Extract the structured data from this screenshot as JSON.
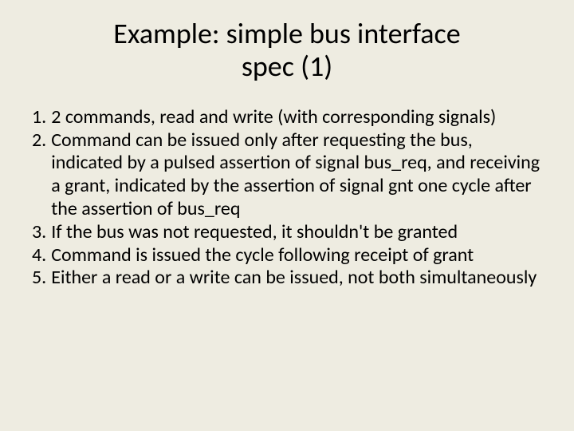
{
  "title": "Example: simple bus interface\nspec (1)",
  "items": [
    {
      "num": "1.",
      "text": "2 commands, read and write (with corresponding signals)"
    },
    {
      "num": "2.",
      "text": "Command can be issued only after requesting the bus, indicated by a pulsed assertion of signal bus_req, and receiving a grant, indicated by the assertion of signal gnt one cycle after the assertion of bus_req"
    },
    {
      "num": "3.",
      "text": "If the bus was not requested, it shouldn't be granted"
    },
    {
      "num": "4.",
      "text": "Command is issued the cycle following receipt of grant"
    },
    {
      "num": "5.",
      "text": "Either a read or a write can be issued, not both simultaneously"
    }
  ]
}
